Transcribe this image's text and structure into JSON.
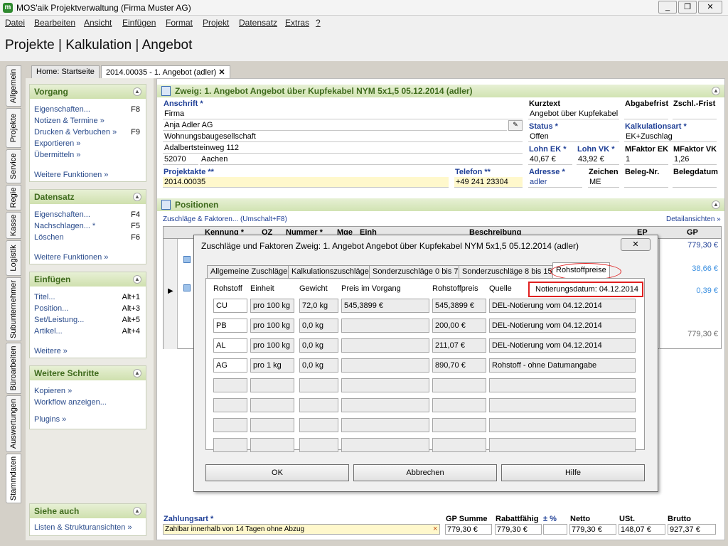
{
  "window": {
    "title": "MOS'aik Projektverwaltung (Firma Muster AG)",
    "controls": [
      "_",
      "❐",
      "✕"
    ]
  },
  "menu": [
    "Datei",
    "Bearbeiten",
    "Ansicht",
    "Einfügen",
    "Format",
    "Projekt",
    "Datensatz",
    "Extras",
    "?"
  ],
  "header": {
    "title": "Projekte | Kalkulation | Angebot"
  },
  "side_tabs": [
    "Allgemein",
    "Projekte",
    "Service",
    "Regie",
    "Kasse",
    "Logistik",
    "Subunternehmer",
    "Büroarbeiten",
    "Auswertungen",
    "Stammdaten"
  ],
  "doc_tabs": [
    {
      "label": "Home: Startseite"
    },
    {
      "label": "2014.00035 - 1. Angebot (adler)",
      "close": "✕"
    }
  ],
  "left_panel": {
    "groups": [
      {
        "title": "Vorgang",
        "items": [
          {
            "label": "Eigenschaften...",
            "key": "F8"
          },
          {
            "label": "Notizen & Termine »",
            "key": ""
          },
          {
            "label": "Drucken & Verbuchen »",
            "key": "F9"
          },
          {
            "label": "Exportieren »",
            "key": ""
          },
          {
            "label": "Übermitteln »",
            "key": ""
          }
        ],
        "more": "Weitere Funktionen »"
      },
      {
        "title": "Datensatz",
        "items": [
          {
            "label": "Eigenschaften...",
            "key": "F4"
          },
          {
            "label": "Nachschlagen... *",
            "key": "F5"
          },
          {
            "label": "Löschen",
            "key": "F6"
          }
        ],
        "more": "Weitere Funktionen »"
      },
      {
        "title": "Einfügen",
        "items": [
          {
            "label": "Titel...",
            "key": "Alt+1"
          },
          {
            "label": "Position...",
            "key": "Alt+3"
          },
          {
            "label": "Set/Leistung...",
            "key": "Alt+5"
          },
          {
            "label": "Artikel...",
            "key": "Alt+4"
          }
        ],
        "more": "Weitere »"
      },
      {
        "title": "Weitere Schritte",
        "items": [
          {
            "label": "Kopieren »",
            "key": ""
          },
          {
            "label": "Workflow anzeigen...",
            "key": ""
          }
        ],
        "more": "Plugins »"
      },
      {
        "title": "Siehe auch",
        "items": [
          {
            "label": "Listen & Strukturansichten »",
            "key": ""
          }
        ],
        "more": ""
      }
    ]
  },
  "zweig": {
    "title": "Zweig: 1. Angebot Angebot über Kupfekabel NYM 5x1,5 05.12.2014 (adler)",
    "anschrift_label": "Anschrift *",
    "anschrift": [
      "Firma",
      "Anja Adler AG",
      "Wohnungsbaugesellschaft",
      "Adalbertsteinweg 112"
    ],
    "plz": "52070",
    "ort": "Aachen",
    "projektakte_label": "Projektakte **",
    "projektakte": "2014.00035",
    "telefon_label": "Telefon **",
    "telefon": "+49 241 23304",
    "kurztext_label": "Kurztext",
    "kurztext": "Angebot über Kupfekabel I",
    "abgabefrist_label": "Abgabefrist",
    "abgabefrist": "",
    "zschl_label": "Zschl.-Frist",
    "zschl": "",
    "status_label": "Status *",
    "status": "Offen",
    "kalkart_label": "Kalkulationsart *",
    "kalkart": "EK+Zuschlag",
    "lohn_ek_label": "Lohn EK *",
    "lohn_ek": "40,67 €",
    "lohn_vk_label": "Lohn VK *",
    "lohn_vk": "43,92 €",
    "mfaktor_ek_label": "MFaktor EK",
    "mfaktor_ek": "1",
    "mfaktor_vk_label": "MFaktor VK",
    "mfaktor_vk": "1,26",
    "adresse_label": "Adresse *",
    "adresse": "adler",
    "zeichen_label": "Zeichen",
    "zeichen": "ME",
    "belegnr_label": "Beleg-Nr.",
    "belegnr": "",
    "belegdatum_label": "Belegdatum",
    "belegdatum": ""
  },
  "positionen": {
    "title": "Positionen",
    "link_left": "Zuschläge & Faktoren... (Umschalt+F8)",
    "link_right": "Detailansichten »",
    "columns": [
      "Kennung *",
      "OZ",
      "Nummer *",
      "Mge",
      "Einh",
      "Beschreibung",
      "EP",
      "GP"
    ],
    "gp_values": [
      "779,30 €",
      "38,66 €",
      "0,39 €",
      "",
      "779,30 €"
    ]
  },
  "footer": {
    "zahlungsart_label": "Zahlungsart *",
    "zahlungsart": "Zahlbar innerhalb von 14 Tagen ohne Abzug",
    "clear": "×",
    "labels": [
      "GP Summe",
      "Rabattfähig",
      "± %",
      "Netto",
      "USt.",
      "Brutto"
    ],
    "values": [
      "779,30 €",
      "779,30 €",
      "",
      "779,30 €",
      "148,07 €",
      "927,37 €"
    ]
  },
  "dialog": {
    "title": "Zuschläge und Faktoren Zweig: 1. Angebot Angebot über Kupfekabel NYM 5x1,5 05.12.2014 (adler)",
    "close": "✕",
    "tabs": [
      "Allgemeine Zuschläge",
      "Kalkulationszuschläge",
      "Sonderzuschläge 0 bis 7",
      "Sonderzuschläge 8 bis 15",
      "Rohstoffpreise"
    ],
    "active_tab": "Rohstoffpreise",
    "columns": [
      "Rohstoff",
      "Einheit",
      "Gewicht",
      "Preis im Vorgang",
      "Rohstoffpreis",
      "Quelle"
    ],
    "notierung": "Notierungsdatum: 04.12.2014",
    "rows": [
      [
        "CU",
        "pro 100 kg",
        "72,0 kg",
        "545,3899 €",
        "545,3899 €",
        "DEL-Notierung vom 04.12.2014"
      ],
      [
        "PB",
        "pro 100 kg",
        "0,0 kg",
        "",
        "200,00 €",
        "DEL-Notierung vom 04.12.2014"
      ],
      [
        "AL",
        "pro 100 kg",
        "0,0 kg",
        "",
        "211,07 €",
        "DEL-Notierung vom 04.12.2014"
      ],
      [
        "AG",
        "pro 1 kg",
        "0,0 kg",
        "",
        "890,70 €",
        "Rohstoff - ohne Datumangabe"
      ],
      [
        "",
        "",
        "",
        "",
        "",
        ""
      ],
      [
        "",
        "",
        "",
        "",
        "",
        ""
      ],
      [
        "",
        "",
        "",
        "",
        "",
        ""
      ],
      [
        "",
        "",
        "",
        "",
        "",
        ""
      ]
    ],
    "buttons": {
      "ok": "OK",
      "cancel": "Abbrechen",
      "help": "Hilfe"
    },
    "highlight_color": "#e02020"
  }
}
